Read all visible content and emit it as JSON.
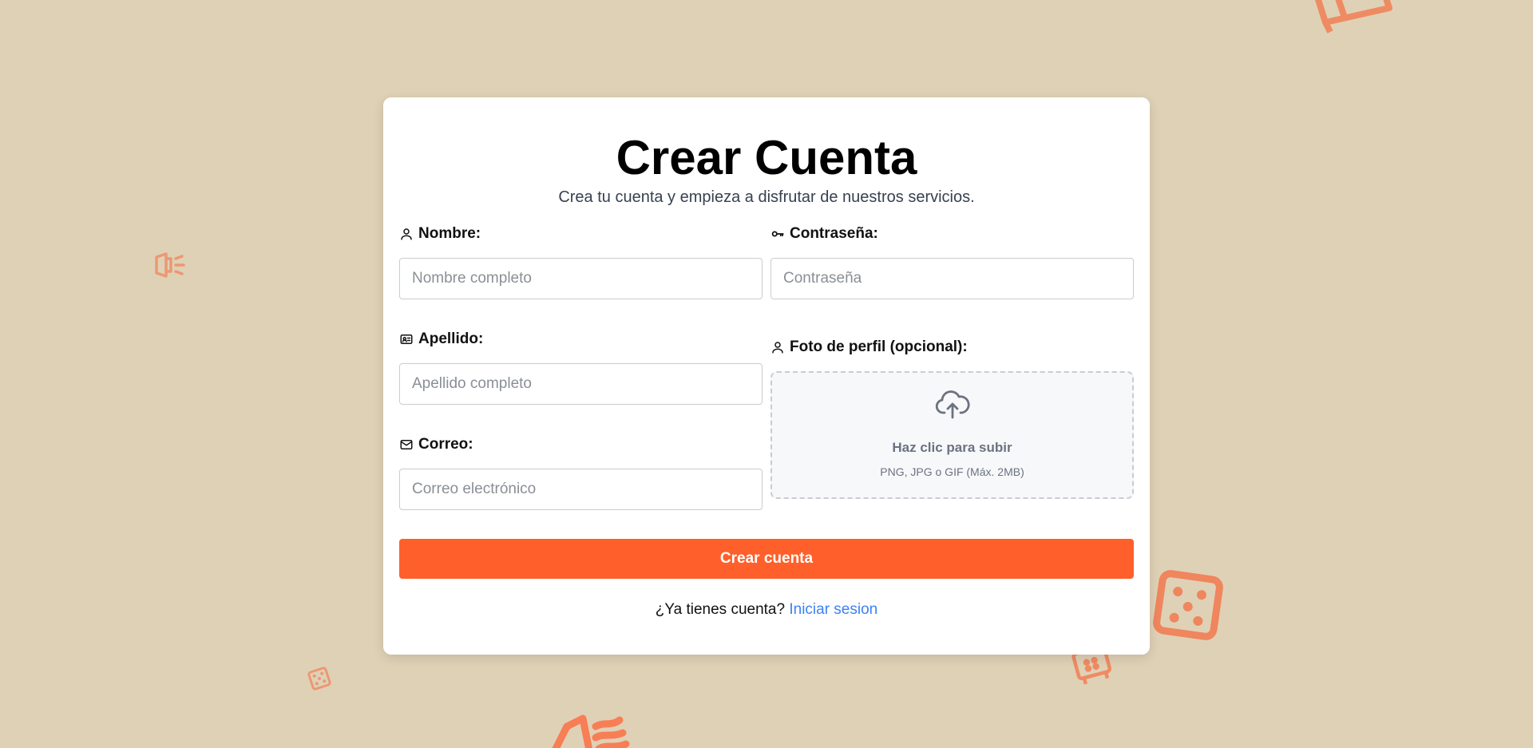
{
  "form": {
    "title": "Crear Cuenta",
    "subtitle": "Crea tu cuenta y empieza a disfrutar de nuestros servicios.",
    "fields": {
      "nombre": {
        "label": "Nombre:",
        "placeholder": "Nombre completo",
        "value": "",
        "icon": "user-icon"
      },
      "apellido": {
        "label": "Apellido:",
        "placeholder": "Apellido completo",
        "value": "",
        "icon": "id-card-icon"
      },
      "correo": {
        "label": "Correo:",
        "placeholder": "Correo electrónico",
        "value": "",
        "icon": "mail-icon"
      },
      "contrasena": {
        "label": "Contraseña:",
        "placeholder": "Contraseña",
        "value": "",
        "icon": "key-icon"
      },
      "foto": {
        "label": "Foto de perfil (opcional):",
        "icon": "user-icon",
        "upload_title": "Haz clic para subir",
        "upload_hint": "PNG, JPG o GIF (Máx. 2MB)",
        "upload_icon": "cloud-upload-icon"
      }
    },
    "submit_label": "Crear cuenta",
    "login_prompt": "¿Ya tienes cuenta?",
    "login_link": "Iniciar sesion"
  },
  "colors": {
    "background": "#dfd1b6",
    "accent": "#ff5f2a",
    "link": "#3b82f6",
    "decor": "#ff6a3d"
  },
  "decorations": [
    "book-icon",
    "megaphone-icon",
    "dice-icon",
    "dice-icon",
    "safe-icon",
    "megaphone-icon"
  ]
}
